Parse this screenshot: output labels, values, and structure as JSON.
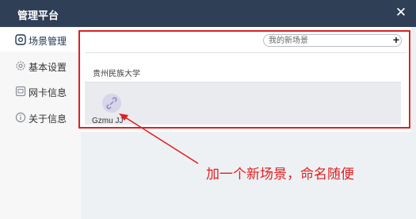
{
  "window": {
    "title": "管理平台",
    "close_glyph": "✕"
  },
  "sidebar": {
    "items": [
      {
        "label": "场景管理",
        "icon": "scene-icon",
        "active": true
      },
      {
        "label": "基本设置",
        "icon": "gear-icon",
        "active": false
      },
      {
        "label": "网卡信息",
        "icon": "network-card-icon",
        "active": false
      },
      {
        "label": "关于信息",
        "icon": "info-icon",
        "active": false
      }
    ]
  },
  "main": {
    "search": {
      "placeholder": "我的新场景",
      "value": ""
    },
    "add_label": "+",
    "section_title": "贵州民族大学",
    "scenes": [
      {
        "name": "Gzmu JJ",
        "icon": "link-broken-icon"
      }
    ]
  },
  "annotation": {
    "text": "加一个新场景，命名随便",
    "color": "#e02020"
  },
  "colors": {
    "titlebar": "#2f3f55",
    "highlight": "#e02020",
    "accent": "#1f3550"
  }
}
